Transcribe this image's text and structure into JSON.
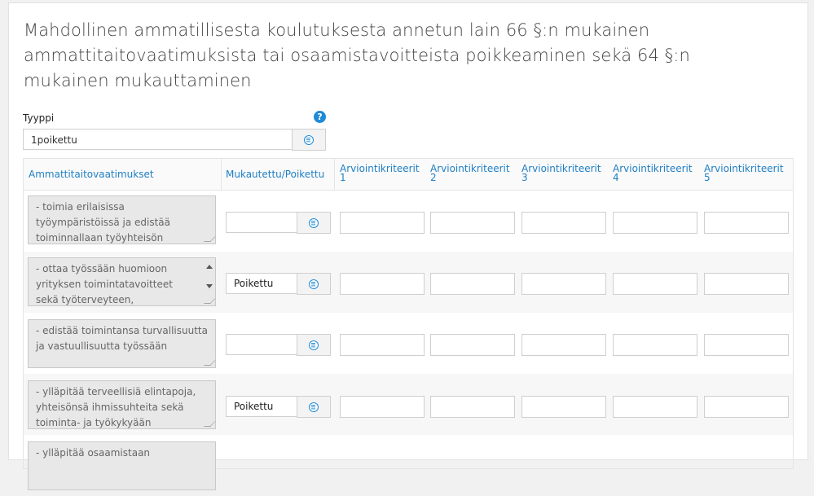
{
  "section": {
    "title": "Mahdollinen ammatillisesta koulutuksesta annetun lain 66 §:n mukainen ammattitaitovaatimuksista tai osaamistavoitteista poikkeaminen sekä 64 §:n mukainen mukauttaminen"
  },
  "type_field": {
    "label": "Tyyppi",
    "value": "1poikettu",
    "help_glyph": "?"
  },
  "table": {
    "headers": {
      "requirements": "Ammattitaitovaatimukset",
      "adapted": "Mukautettu/Poikettu",
      "criteria1": "Arviointikriteerit 1",
      "criteria2": "Arviointikriteerit 2",
      "criteria3": "Arviointikriteerit 3",
      "criteria4": "Arviointikriteerit 4",
      "criteria5": "Arviointikriteerit 5"
    },
    "rows": [
      {
        "requirement": " - toimia erilaisissa työympäristöissä ja edistää toiminnallaan työyhteisön työhyvinvointia",
        "status": ""
      },
      {
        "requirement": " - ottaa työssään huomioon yrityksen toimintatavoitteet sekä työterveyteen, työturvallisuuteen",
        "status": "Poikettu"
      },
      {
        "requirement": " - edistää toimintansa turvallisuutta ja vastuullisuutta työssään",
        "status": ""
      },
      {
        "requirement": " - ylläpitää terveellisiä elintapoja, yhteisönsä ihmissuhteita sekä toiminta- ja työkykyään",
        "status": "Poikettu"
      },
      {
        "requirement": " - ylläpitää osaamistaan",
        "status": ""
      }
    ]
  },
  "colors": {
    "accent": "#1f8ad6",
    "header_text": "#1f7fc4"
  },
  "icons": {
    "help": "question-circle-icon",
    "select": "list-circle-icon"
  }
}
